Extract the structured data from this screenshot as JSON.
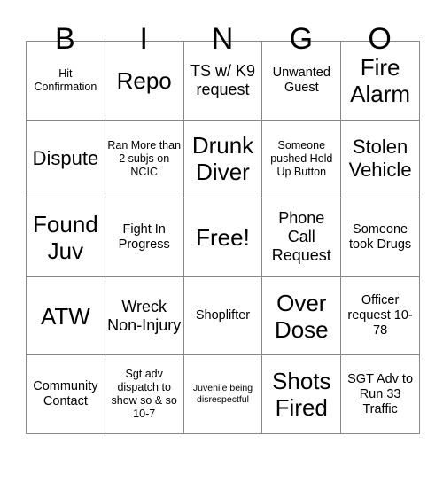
{
  "card": {
    "title": "BINGO",
    "headers": [
      "B",
      "I",
      "N",
      "G",
      "O"
    ],
    "rows": [
      [
        {
          "text": "Hit Confirmation",
          "size": "fs-s"
        },
        {
          "text": "Repo",
          "size": "fs-xxl"
        },
        {
          "text": "TS w/ K9 request",
          "size": "fs-l"
        },
        {
          "text": "Unwanted Guest",
          "size": "fs-m"
        },
        {
          "text": "Fire Alarm",
          "size": "fs-xxl"
        }
      ],
      [
        {
          "text": "Dispute",
          "size": "fs-xl"
        },
        {
          "text": "Ran More than 2 subjs on NCIC",
          "size": "fs-s"
        },
        {
          "text": "Drunk Diver",
          "size": "fs-xxl"
        },
        {
          "text": "Someone pushed Hold Up Button",
          "size": "fs-s"
        },
        {
          "text": "Stolen Vehicle",
          "size": "fs-xl"
        }
      ],
      [
        {
          "text": "Found Juv",
          "size": "fs-xxl"
        },
        {
          "text": "Fight In Progress",
          "size": "fs-m"
        },
        {
          "text": "Free!",
          "size": "fs-xxl"
        },
        {
          "text": "Phone Call Request",
          "size": "fs-l"
        },
        {
          "text": "Someone took Drugs",
          "size": "fs-m"
        }
      ],
      [
        {
          "text": "ATW",
          "size": "fs-xxl"
        },
        {
          "text": "Wreck Non-Injury",
          "size": "fs-l"
        },
        {
          "text": "Shoplifter",
          "size": "fs-m"
        },
        {
          "text": "Over Dose",
          "size": "fs-xxl"
        },
        {
          "text": "Officer request 10-78",
          "size": "fs-m"
        }
      ],
      [
        {
          "text": "Community Contact",
          "size": "fs-m"
        },
        {
          "text": "Sgt adv dispatch to show so & so 10-7",
          "size": "fs-s"
        },
        {
          "text": "Juvenile being disrespectful",
          "size": "fs-xs"
        },
        {
          "text": "Shots Fired",
          "size": "fs-xxl"
        },
        {
          "text": "SGT Adv to Run 33 Traffic",
          "size": "fs-m"
        }
      ]
    ]
  },
  "colors": {
    "border": "#888888",
    "text": "#000000",
    "background": "#ffffff"
  }
}
